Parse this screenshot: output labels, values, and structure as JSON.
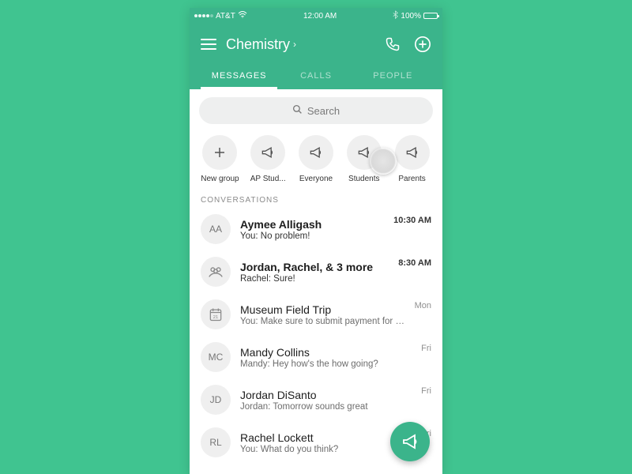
{
  "status": {
    "carrier": "AT&T",
    "time": "12:00 AM",
    "battery_pct": "100%"
  },
  "header": {
    "title": "Chemistry"
  },
  "tabs": [
    {
      "label": "MESSAGES",
      "active": true
    },
    {
      "label": "CALLS",
      "active": false
    },
    {
      "label": "PEOPLE",
      "active": false
    }
  ],
  "search": {
    "placeholder": "Search"
  },
  "groups": [
    {
      "label": "New group",
      "icon": "plus"
    },
    {
      "label": "AP Stud...",
      "icon": "megaphone"
    },
    {
      "label": "Everyone",
      "icon": "megaphone"
    },
    {
      "label": "Students",
      "icon": "megaphone"
    },
    {
      "label": "Parents",
      "icon": "megaphone"
    }
  ],
  "section_label": "CONVERSATIONS",
  "conversations": [
    {
      "avatar": "AA",
      "avatar_type": "initials",
      "title": "Aymee Alligash",
      "preview": "You: No problem!",
      "time": "10:30 AM"
    },
    {
      "avatar": "group",
      "avatar_type": "icon",
      "title": "Jordan, Rachel, & 3 more",
      "preview": "Rachel: Sure!",
      "time": "8:30 AM"
    },
    {
      "avatar": "calendar",
      "avatar_type": "icon",
      "title": "Museum Field Trip",
      "preview": "You: Make sure to submit payment for t...",
      "time": "Mon"
    },
    {
      "avatar": "MC",
      "avatar_type": "initials",
      "title": "Mandy Collins",
      "preview": "Mandy: Hey how's the how going?",
      "time": "Fri"
    },
    {
      "avatar": "JD",
      "avatar_type": "initials",
      "title": "Jordan DiSanto",
      "preview": "Jordan: Tomorrow sounds great",
      "time": "Fri"
    },
    {
      "avatar": "RL",
      "avatar_type": "initials",
      "title": "Rachel Lockett",
      "preview": "You: What do you think?",
      "time": "Fri"
    }
  ]
}
